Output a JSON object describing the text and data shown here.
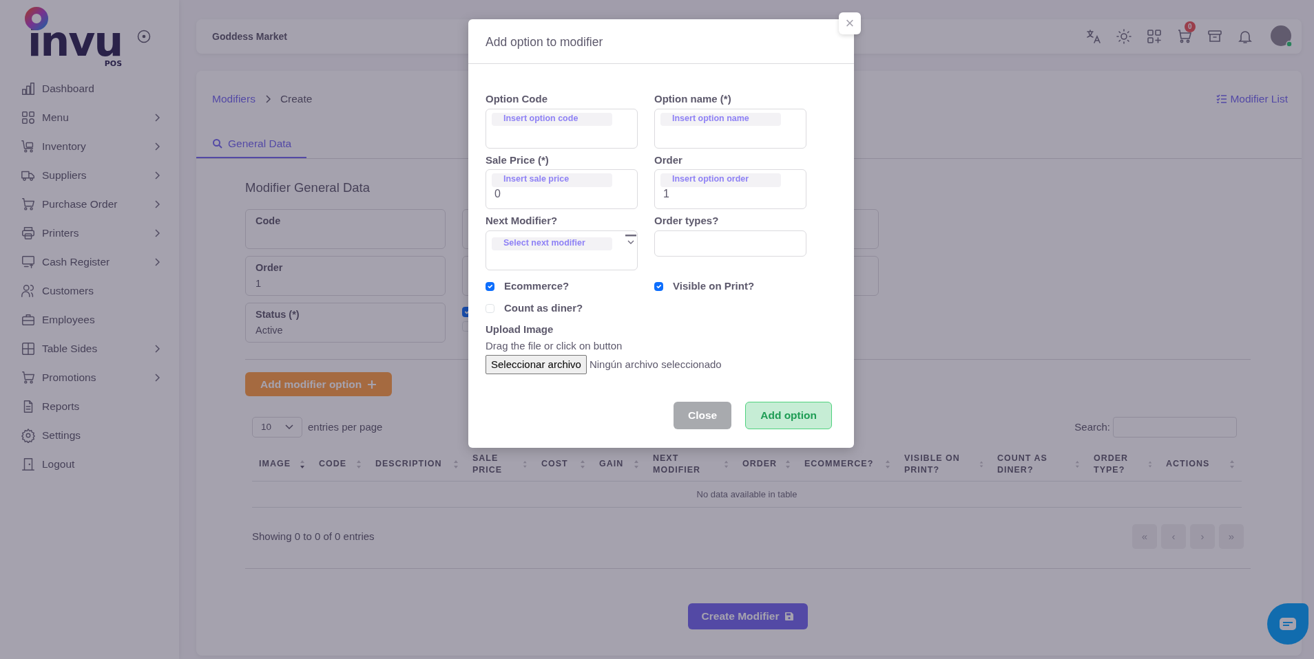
{
  "sidebar": {
    "logo_text": "invu",
    "logo_sub": "POS",
    "items": [
      {
        "label": "Dashboard",
        "expandable": false
      },
      {
        "label": "Menu",
        "expandable": true
      },
      {
        "label": "Inventory",
        "expandable": true
      },
      {
        "label": "Suppliers",
        "expandable": true
      },
      {
        "label": "Purchase Order",
        "expandable": true
      },
      {
        "label": "Printers",
        "expandable": true
      },
      {
        "label": "Cash Register",
        "expandable": true
      },
      {
        "label": "Customers",
        "expandable": false
      },
      {
        "label": "Employees",
        "expandable": false
      },
      {
        "label": "Table Sides",
        "expandable": true
      },
      {
        "label": "Promotions",
        "expandable": true
      },
      {
        "label": "Reports",
        "expandable": false
      },
      {
        "label": "Settings",
        "expandable": false
      },
      {
        "label": "Logout",
        "expandable": false
      }
    ]
  },
  "header": {
    "store": "Goddess Market",
    "cart_badge": "0"
  },
  "breadcrumb": [
    {
      "label": "Modifiers",
      "link": true
    },
    {
      "label": "Create",
      "link": false
    }
  ],
  "list_link": "Modifier List",
  "tabs": [
    {
      "label": "General Data",
      "selected": true
    }
  ],
  "section_title": "Modifier General Data",
  "fields": [
    {
      "label": "Code"
    },
    {
      "label": "Order",
      "value": "1"
    },
    {
      "label": "Status (*)",
      "value": "Active"
    }
  ],
  "side_checks": [
    {
      "checked": true
    },
    {
      "checked": false
    }
  ],
  "add_button": "Add modifier option",
  "entries": {
    "value": "10",
    "label": "entries per page"
  },
  "search_label": "Search:",
  "table": {
    "columns": [
      {
        "label": "IMAGE",
        "sorted": true
      },
      {
        "label": "CODE",
        "sorted": false
      },
      {
        "label": "DESCRIPTION",
        "sorted": false
      },
      {
        "label": "SALE PRICE",
        "sorted": false
      },
      {
        "label": "COST",
        "sorted": false
      },
      {
        "label": "GAIN",
        "sorted": false
      },
      {
        "label": "NEXT MODIFIER",
        "sorted": false
      },
      {
        "label": "ORDER",
        "sorted": false
      },
      {
        "label": "ECOMMERCE?",
        "sorted": false
      },
      {
        "label": "VISIBLE ON PRINT?",
        "sorted": false
      },
      {
        "label": "COUNT AS DINER?",
        "sorted": false
      },
      {
        "label": "ORDER TYPE?",
        "sorted": false
      },
      {
        "label": "ACTIONS",
        "sorted": false
      }
    ],
    "empty": "No data available in table"
  },
  "info": "Showing 0 to 0 of 0 entries",
  "pagination": [
    {
      "label": "«",
      "disabled": true
    },
    {
      "label": "‹",
      "disabled": true
    },
    {
      "label": "›",
      "disabled": true
    },
    {
      "label": "»",
      "disabled": true
    }
  ],
  "submit": "Create Modifier",
  "modal": {
    "title": "Add option to modifier",
    "close_symbol": "×",
    "fields": [
      {
        "kind": "text",
        "label": "Option Code",
        "placeholder": "Insert option code"
      },
      {
        "kind": "text",
        "label": "Option name (*)",
        "placeholder": "Insert option name"
      },
      {
        "kind": "text",
        "label": "Sale Price (*)",
        "placeholder": "Insert sale price",
        "value": "0"
      },
      {
        "kind": "text",
        "label": "Order",
        "placeholder": "Insert option order",
        "value": "1"
      },
      {
        "kind": "select",
        "label": "Next Modifier?",
        "placeholder": "Select next modifier"
      },
      {
        "kind": "plain",
        "label": "Order types?"
      }
    ],
    "checks": [
      {
        "label": "Ecommerce?",
        "checked": true
      },
      {
        "label": "Visible on Print?",
        "checked": true
      },
      {
        "label": "Count as diner?",
        "checked": false
      }
    ],
    "upload_label": "Upload Image",
    "upload_hint": "Drag the file or click on button",
    "file_button": "Seleccionar archivo",
    "file_status": "Ningún archivo seleccionado",
    "buttons": [
      {
        "label": "Close",
        "kind": "secondary"
      },
      {
        "label": "Add option",
        "kind": "success"
      }
    ]
  }
}
